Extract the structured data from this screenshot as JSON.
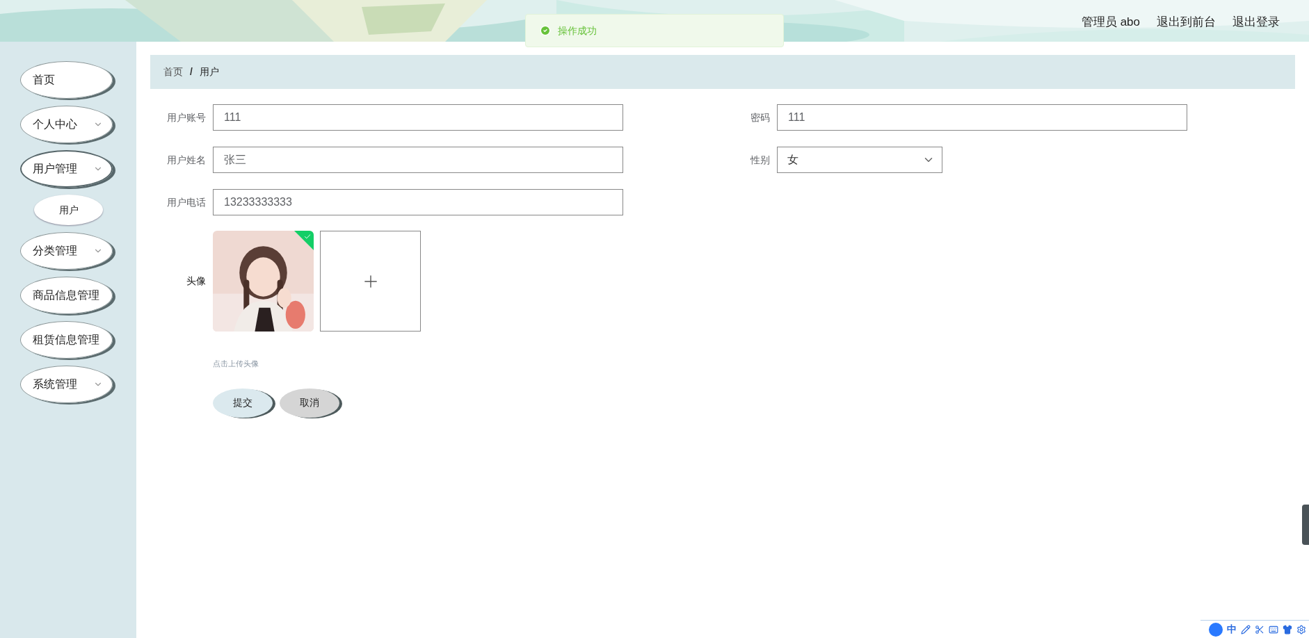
{
  "header": {
    "links": [
      "管理员 abo",
      "退出到前台",
      "退出登录"
    ]
  },
  "toast": {
    "message": "操作成功",
    "kind": "success"
  },
  "sidebar": {
    "items": [
      {
        "label": "首页",
        "kind": "link",
        "expanded": false
      },
      {
        "label": "个人中心",
        "kind": "group",
        "expanded": false
      },
      {
        "label": "用户管理",
        "kind": "group",
        "expanded": true,
        "children": [
          {
            "label": "用户",
            "selected": true
          }
        ]
      },
      {
        "label": "分类管理",
        "kind": "group",
        "expanded": false
      },
      {
        "label": "商品信息管理",
        "kind": "link",
        "expanded": false
      },
      {
        "label": "租赁信息管理",
        "kind": "link",
        "expanded": false
      },
      {
        "label": "系统管理",
        "kind": "group",
        "expanded": false
      }
    ]
  },
  "breadcrumb": {
    "separator": "/",
    "items": [
      "首页",
      "用户"
    ]
  },
  "form": {
    "left": [
      {
        "label": "用户账号",
        "value": "111",
        "kind": "input"
      },
      {
        "label": "用户姓名",
        "value": "张三",
        "kind": "input"
      },
      {
        "label": "用户电话",
        "value": "13233333333",
        "kind": "input"
      }
    ],
    "right": [
      {
        "label": "密码",
        "value": "111",
        "kind": "input"
      },
      {
        "label": "性别",
        "value": "女",
        "kind": "select"
      }
    ],
    "avatar": {
      "label": "头像",
      "uploaded": true,
      "hint": "点击上传头像"
    },
    "buttons": [
      {
        "label": "提交",
        "kind": "primary"
      },
      {
        "label": "取消",
        "kind": "secondary"
      }
    ]
  },
  "ime_bar": {
    "mode": "中"
  }
}
